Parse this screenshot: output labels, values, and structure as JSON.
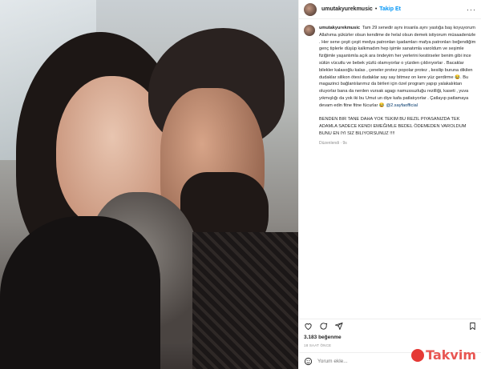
{
  "post": {
    "username": "umutakyurekmusic",
    "separator": "•",
    "follow_label": "Takip Et",
    "more_label": "···"
  },
  "caption": {
    "username": "umutakyurekmusic",
    "text": "Tam 29 senedir aynı insanla aynı yastığa baş koyuyorum Allahıma şükürler olsun kendime de helal olsun demek istiyorum müsaadenizle . Her sene çeşit çeşit medya patronları işadamları mafya patronları beğendiğim genç tiplerle düşüp kalkmadım hep işimle sanatımla varoldum ve seşimle fiziğimle yaşantımla açık ara öndeyim her yerlerini kestirseler benim gibi ince sülün vücutlu ve bebek yüzlü olamıyorlar o yüzden çıldırıyorlar . Bacaklar bilekler kalasoğlu kalas , çeneler protez popolar protez , kesilip buruna dikilen dudaklar silikon ötesi dudaklar say say bitmez on kere yüz gerdirme 😂. Bu magazinci bağlantılarımız da birileri için özel program yapıp yalakalıktan oluyorlar bana da nerden vursak agagı namussuzluğu rezilliği, kaseti , yuva yıkmışlığı da yok iki bu Umut un diye kafa patlatıyorlar . Çatlayıp patlamaya devam edin fitne fitne fücurlar 😂 ",
    "mention": "@2.sayfaofficial",
    "caps": "BENDEN BIR TANE DAHA YOK TEKIM BU REZIL PIYASANIZDA TEK ADAMLA SADECE KENDI EMEĞIMLE BEDEL ÖDEMEDEN VAROLDUM BUNU EN IYI SIZ BILIYORSUNUZ !!!!",
    "meta": "Düzenlendi · 9s"
  },
  "engagement": {
    "likes": "3.183 beğenme",
    "time": "18 SAAT ÖNCE"
  },
  "comment": {
    "placeholder": "Yorum ekle..."
  },
  "watermark": {
    "text": "Takvim"
  },
  "icons": {
    "heart": "heart-icon",
    "comment": "comment-icon",
    "share": "share-icon",
    "save": "bookmark-icon",
    "emoji": "emoji-icon"
  },
  "colors": {
    "link": "#0095f6",
    "mention": "#00376b",
    "watermark": "#e53935"
  }
}
